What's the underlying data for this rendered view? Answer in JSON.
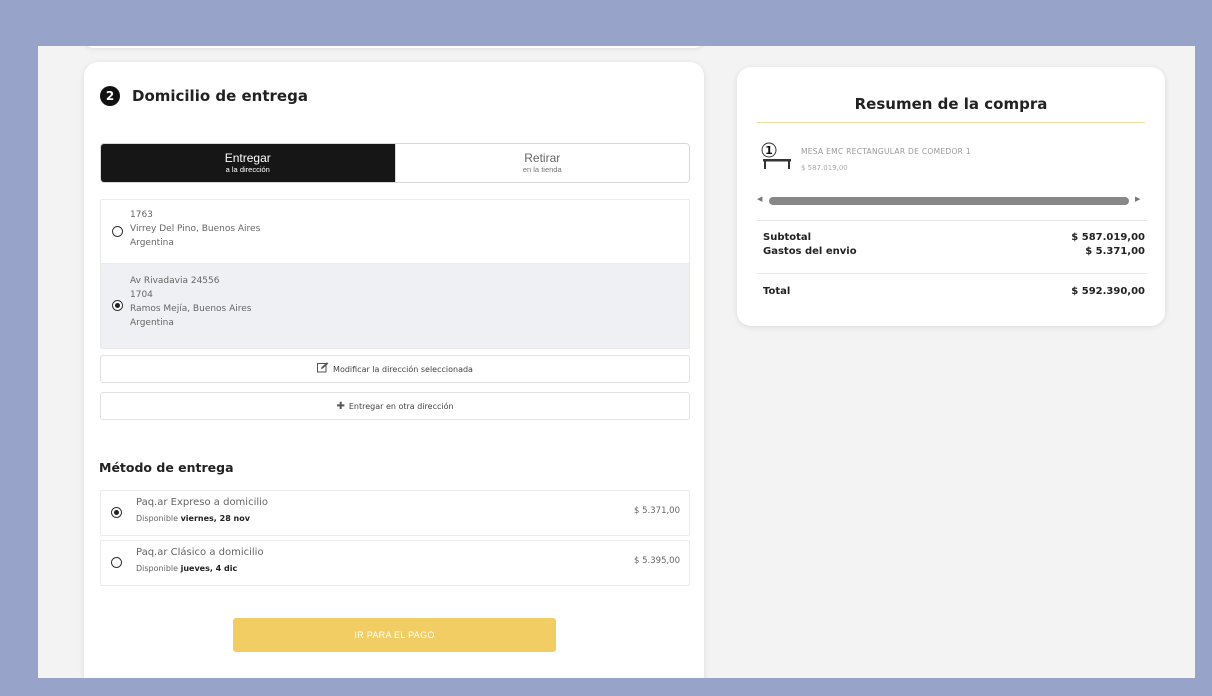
{
  "delivery": {
    "step_number": "2",
    "title": "Domicilio de entrega",
    "tabs": [
      {
        "label": "Entregar",
        "sublabel": "a la dirección",
        "active": true
      },
      {
        "label": "Retirar",
        "sublabel": "en la tienda",
        "active": false
      }
    ],
    "addresses": [
      {
        "lines": [
          "1763",
          "Virrey Del Pino, Buenos Aires",
          "Argentina"
        ],
        "selected": false
      },
      {
        "lines": [
          "Av Rivadavia 24556",
          "1704",
          "Ramos Mejía, Buenos Aires",
          "Argentina"
        ],
        "selected": true
      }
    ],
    "modify_label": "Modificar la dirección seleccionada",
    "add_label": "Entregar en otra dirección"
  },
  "shipping": {
    "title": "Método de entrega",
    "methods": [
      {
        "name": "Paq.ar Expreso a domicilio",
        "available_prefix": "Disponible",
        "available_date": "viernes, 28 nov",
        "price": "$ 5.371,00",
        "selected": true
      },
      {
        "name": "Paq.ar Clásico a domicilio",
        "available_prefix": "Disponible",
        "available_date": "jueves, 4 dic",
        "price": "$ 5.395,00",
        "selected": false
      }
    ]
  },
  "pay_button": "IR PARA EL PAGO",
  "summary": {
    "title": "Resumen de la compra",
    "product": {
      "quantity": "1",
      "name": "MESA EMC RECTANGULAR DE COMEDOR 1",
      "price": "$ 587.019,00"
    },
    "subtotal_label": "Subtotal",
    "subtotal_value": "$ 587.019,00",
    "shipping_label": "Gastos del envio",
    "shipping_value": "$ 5.371,00",
    "total_label": "Total",
    "total_value": "$ 592.390,00"
  },
  "colors": {
    "outer_background": "#97a3c8",
    "page_background": "#f3f3f3",
    "active_tab": "#161616",
    "pay_button": "#f2cd63",
    "selected_row": "#eef0f3",
    "summary_rule": "#ecdca0"
  }
}
